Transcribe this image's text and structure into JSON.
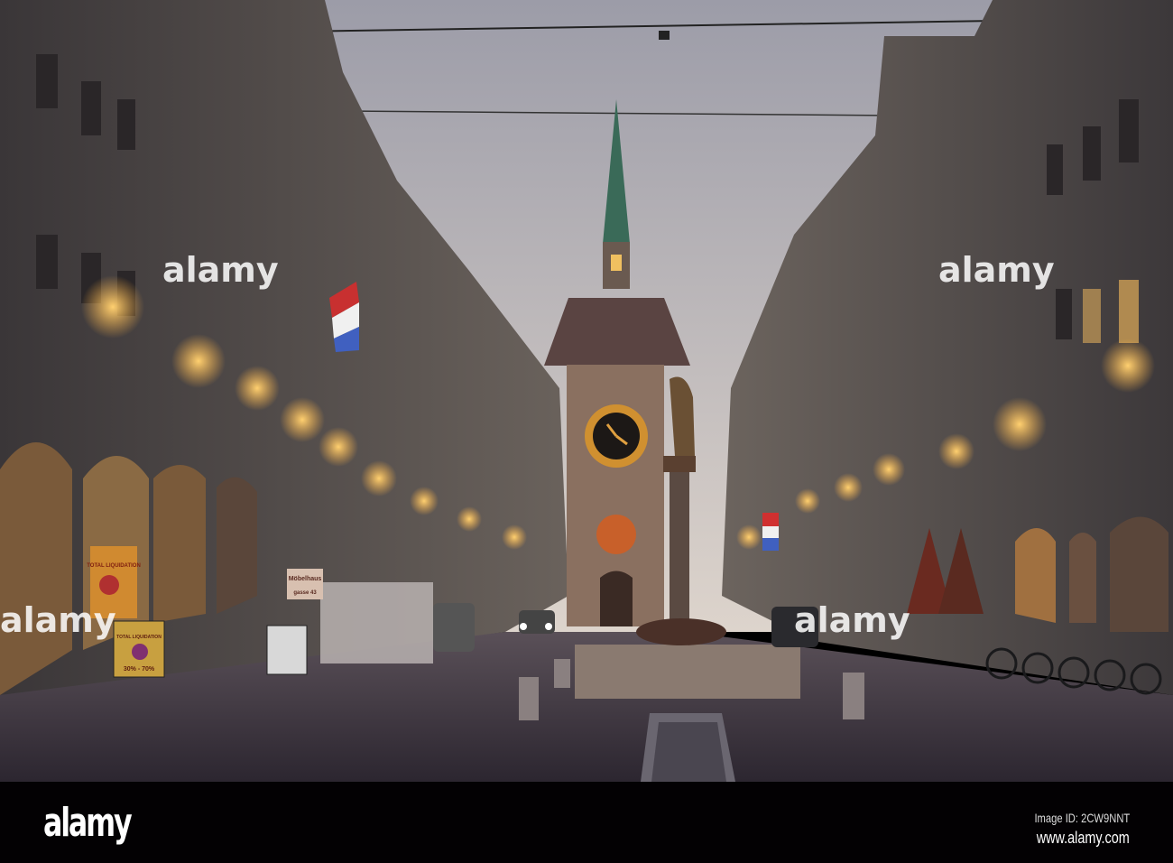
{
  "photo": {
    "subject": "Kramgasse street with Zytglogge clock tower at dusk",
    "signs": {
      "sale_title": "TOTAL LIQUIDATION",
      "sale_discount": "30% - 70%",
      "shop_name": "Möbelhaus",
      "shop_address": "gasse 43"
    },
    "watermark": "alamy"
  },
  "footer": {
    "logo": "alamy",
    "image_id": "Image ID: 2CW9NNT",
    "website": "www.alamy.com"
  },
  "colors": {
    "sky_top": "#9a9aa6",
    "sky_bottom": "#d9d2cc",
    "street": "#4a4250",
    "lights": "#f0b040",
    "footer": "#030103"
  }
}
